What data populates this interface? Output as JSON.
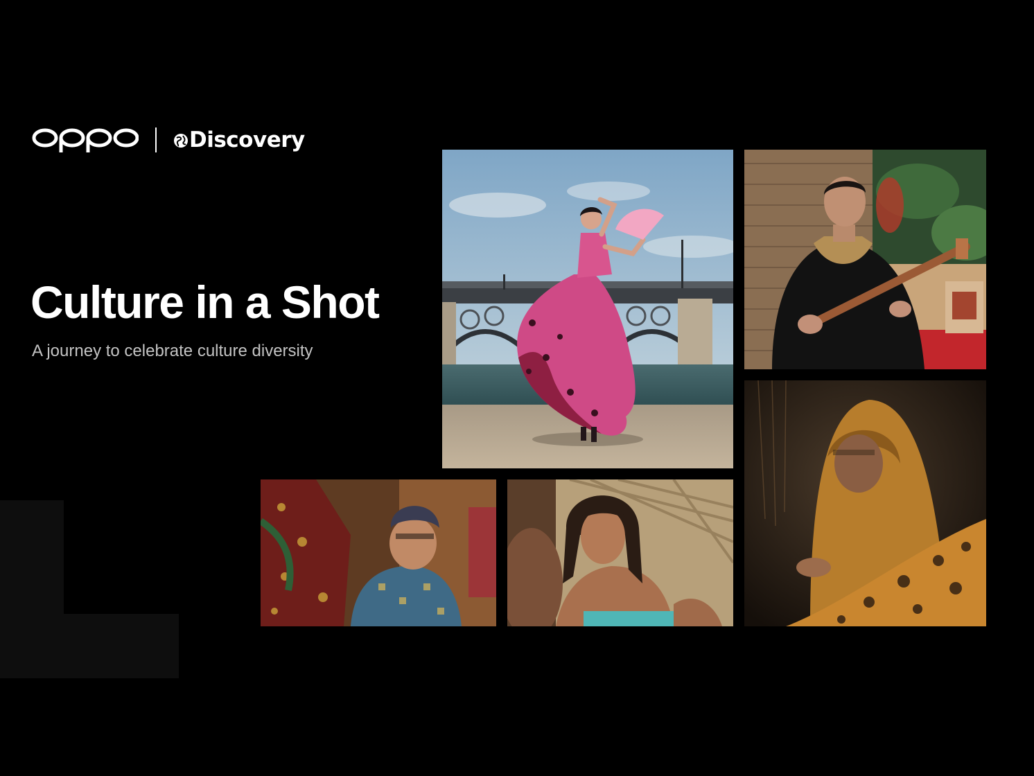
{
  "brand": {
    "oppo_logo": "OPPO",
    "partner_logo": "Discovery",
    "partner_icon": "globe-icon"
  },
  "hero": {
    "title": "Culture in a Shot",
    "subtitle": "A journey to celebrate culture diversity"
  },
  "gallery": {
    "photos": [
      "flamenco-dancer-photo",
      "string-instrument-musician-photo",
      "batik-artisan-photo",
      "elder-with-puppets-photo",
      "child-portrait-photo"
    ]
  },
  "colors": {
    "background": "#000000",
    "text_primary": "#ffffff",
    "text_secondary": "#c4c4c4",
    "accent_pink": "#d8457e"
  }
}
